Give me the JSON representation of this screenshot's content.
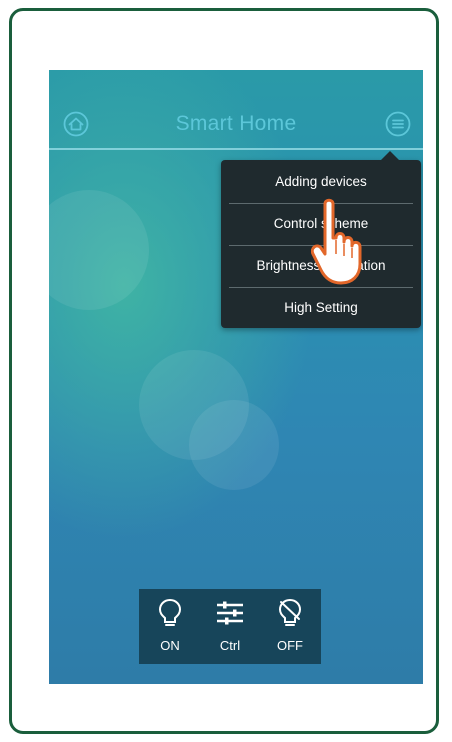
{
  "app": {
    "title": "Smart Home"
  },
  "header": {
    "home_icon": "home-icon",
    "menu_icon": "menu-icon"
  },
  "menu": {
    "items": [
      {
        "label": "Adding devices"
      },
      {
        "label": "Control scheme"
      },
      {
        "label": "Brightness calibration"
      },
      {
        "label": "High Setting"
      }
    ]
  },
  "bottom_bar": {
    "items": [
      {
        "label": "ON",
        "icon": "bulb-on-icon"
      },
      {
        "label": "Ctrl",
        "icon": "sliders-icon"
      },
      {
        "label": "OFF",
        "icon": "bulb-off-icon"
      }
    ]
  },
  "colors": {
    "frame_border": "#1a5e3c",
    "title": "#5cc7d9",
    "menu_bg": "#1f2a2e",
    "bottom_bar_bg": "#17455a",
    "hand_outline": "#e2672a"
  }
}
